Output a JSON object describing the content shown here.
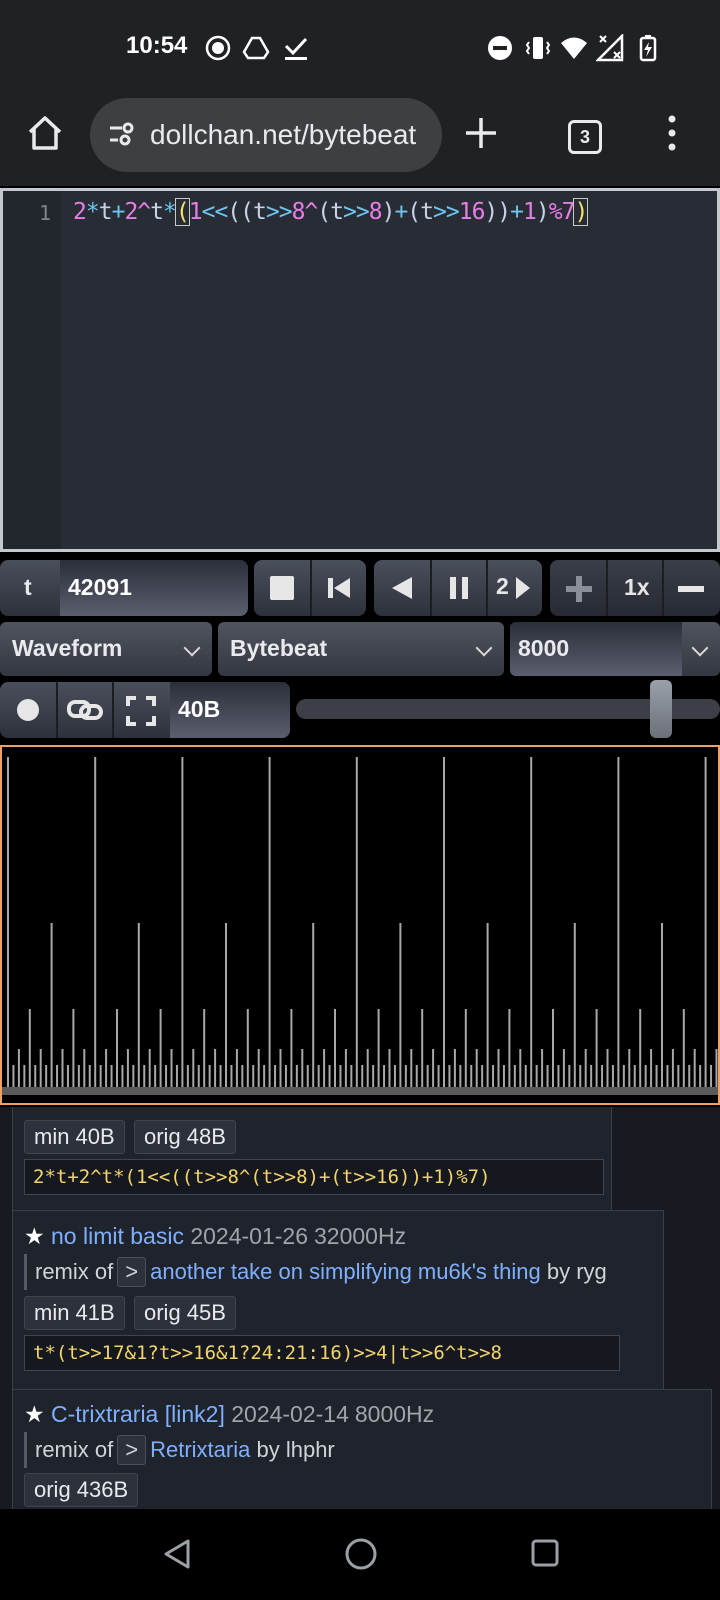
{
  "status": {
    "time": "10:54"
  },
  "browser": {
    "url": "dollchan.net/bytebeat",
    "tab_count": "3"
  },
  "editor": {
    "line_number": "1",
    "code": "2*t+2^t*(1<<((t>>8^(t>>8)+(t>>16))+1)%7)"
  },
  "controls": {
    "time_label": "t",
    "time_value": "42091",
    "speed_label": "2",
    "rate_multiplier": "1x",
    "mode_select": "Waveform",
    "type_select": "Bytebeat",
    "sample_rate": "8000",
    "code_size": "40B",
    "volume_level": 0.88
  },
  "library": {
    "entries": [
      {
        "min_size": "min 40B",
        "orig_size": "orig 48B",
        "code": "2*t+2^t*(1<<((t>>8^(t>>8)+(t>>16))+1)%7)"
      },
      {
        "title": "no limit basic",
        "date": "2024-01-26",
        "rate": "32000Hz",
        "remix_prefix": "remix of",
        "remix_title": "another take on simplifying mu6k's thing",
        "remix_by": "by ryg",
        "min_size": "min 41B",
        "orig_size": "orig 45B",
        "code": "t*(t>>17&1?t>>16&1?24:21:16)>>4|t>>6^t>>8"
      },
      {
        "title": "C-trixtraria",
        "extra_link": "[link2]",
        "date": "2024-02-14",
        "rate": "8000Hz",
        "remix_prefix": "remix of",
        "remix_title": "Retrixtaria",
        "remix_by": "by lhphr",
        "orig_size": "orig 436B"
      }
    ]
  },
  "colors": {
    "accent_border": "#f0a060",
    "link": "#7fb0ff",
    "code_number": "#e97ee8",
    "code_operator": "#6fc6f2",
    "library_code": "#f4d36b"
  }
}
